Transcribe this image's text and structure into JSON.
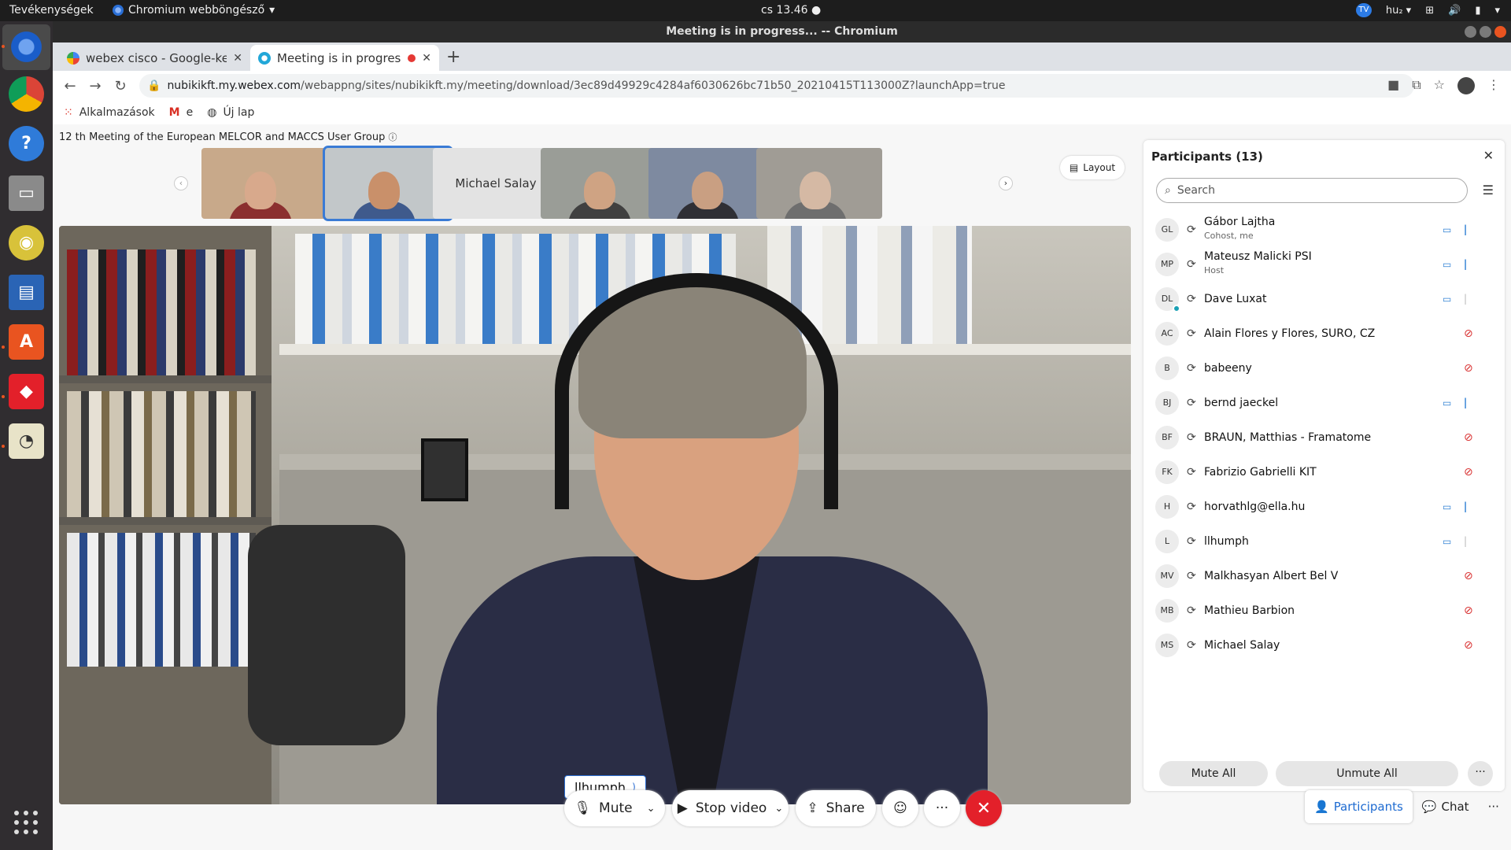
{
  "topbar": {
    "activities": "Tevékenységek",
    "app_name": "Chromium webböngésző",
    "clock": "cs 13.46",
    "keyboard_layout": "hu₂",
    "teamviewer_label": "TV"
  },
  "window": {
    "title": "Meeting is in progress... -- Chromium"
  },
  "tabs": [
    {
      "label": "webex cisco - Google-kere",
      "favicon": "google-icon"
    },
    {
      "label": "Meeting is in progress",
      "favicon": "webex-icon",
      "recording": true
    }
  ],
  "toolbar": {
    "url_host": "nubikikft.my.webex.com",
    "url_path": "/webappng/sites/nubikikft.my/meeting/download/3ec89d49929c4284af6030626bc71b50_20210415T113000Z?launchApp=true"
  },
  "bookmarks": [
    {
      "label": "Alkalmazások",
      "icon": "apps-grid-icon"
    },
    {
      "label": "e",
      "icon": "gmail-icon"
    },
    {
      "label": "Új lap",
      "icon": "globe-icon"
    }
  ],
  "meeting": {
    "title": "12 th Meeting of the European MELCOR and MACCS User Group",
    "layout_label": "Layout",
    "thumbnails": [
      {
        "type": "video",
        "colors": {
          "bg": "#c8a98a",
          "face": "#d8a98c",
          "body": "#8b2f2f"
        }
      },
      {
        "type": "video",
        "selected": true,
        "colors": {
          "bg": "#c2c7c9",
          "face": "#c9906a",
          "body": "#3f5a8c"
        }
      },
      {
        "type": "name",
        "name": "Michael Salay"
      },
      {
        "type": "video",
        "colors": {
          "bg": "#9a9d97",
          "face": "#cfa383",
          "body": "#404040"
        }
      },
      {
        "type": "video",
        "colors": {
          "bg": "#7e8aa0",
          "face": "#c99f82",
          "body": "#2f2f35"
        }
      },
      {
        "type": "video",
        "colors": {
          "bg": "#a09c95",
          "face": "#d5b9a4",
          "body": "#6e6e6e"
        }
      }
    ],
    "active_speaker": "llhumph"
  },
  "controls": {
    "mute_label": "Mute",
    "stop_video_label": "Stop video",
    "share_label": "Share",
    "more_label": "···"
  },
  "participants_panel": {
    "title": "Participants (13)",
    "search_placeholder": "Search",
    "mute_all_label": "Mute All",
    "unmute_all_label": "Unmute All",
    "more_label": "···",
    "participants": [
      {
        "initials": "GL",
        "name": "Gábor Lajtha",
        "subtitle": "Cohost, me",
        "video": true,
        "mic": "on"
      },
      {
        "initials": "MP",
        "name": "Mateusz Malicki PSI",
        "subtitle": "Host",
        "video": true,
        "mic": "on"
      },
      {
        "initials": "DL",
        "name": "Dave Luxat",
        "subtitle": "",
        "video": true,
        "mic": "dim",
        "online": true
      },
      {
        "initials": "AC",
        "name": "Alain Flores y Flores, SURO, CZ",
        "subtitle": "",
        "video": false,
        "mic": "off"
      },
      {
        "initials": "B",
        "name": "babeeny",
        "subtitle": "",
        "video": false,
        "mic": "off"
      },
      {
        "initials": "BJ",
        "name": "bernd jaeckel",
        "subtitle": "",
        "video": true,
        "mic": "on"
      },
      {
        "initials": "BF",
        "name": "BRAUN, Matthias - Framatome",
        "subtitle": "",
        "video": false,
        "mic": "off"
      },
      {
        "initials": "FK",
        "name": "Fabrizio Gabrielli KIT",
        "subtitle": "",
        "video": false,
        "mic": "off"
      },
      {
        "initials": "H",
        "name": "horvathlg@ella.hu",
        "subtitle": "",
        "video": true,
        "mic": "on"
      },
      {
        "initials": "L",
        "name": "llhumph",
        "subtitle": "",
        "video": true,
        "mic": "dim"
      },
      {
        "initials": "MV",
        "name": "Malkhasyan Albert Bel V",
        "subtitle": "",
        "video": false,
        "mic": "off"
      },
      {
        "initials": "MB",
        "name": "Mathieu Barbion",
        "subtitle": "",
        "video": false,
        "mic": "off"
      },
      {
        "initials": "MS",
        "name": "Michael Salay",
        "subtitle": "",
        "video": false,
        "mic": "off"
      }
    ]
  },
  "bottom_tabs": {
    "participants_label": "Participants",
    "chat_label": "Chat",
    "more_label": "···"
  },
  "colors": {
    "accent": "#1e6bd1",
    "end_call": "#e3202a",
    "ubuntu_orange": "#e95420"
  }
}
